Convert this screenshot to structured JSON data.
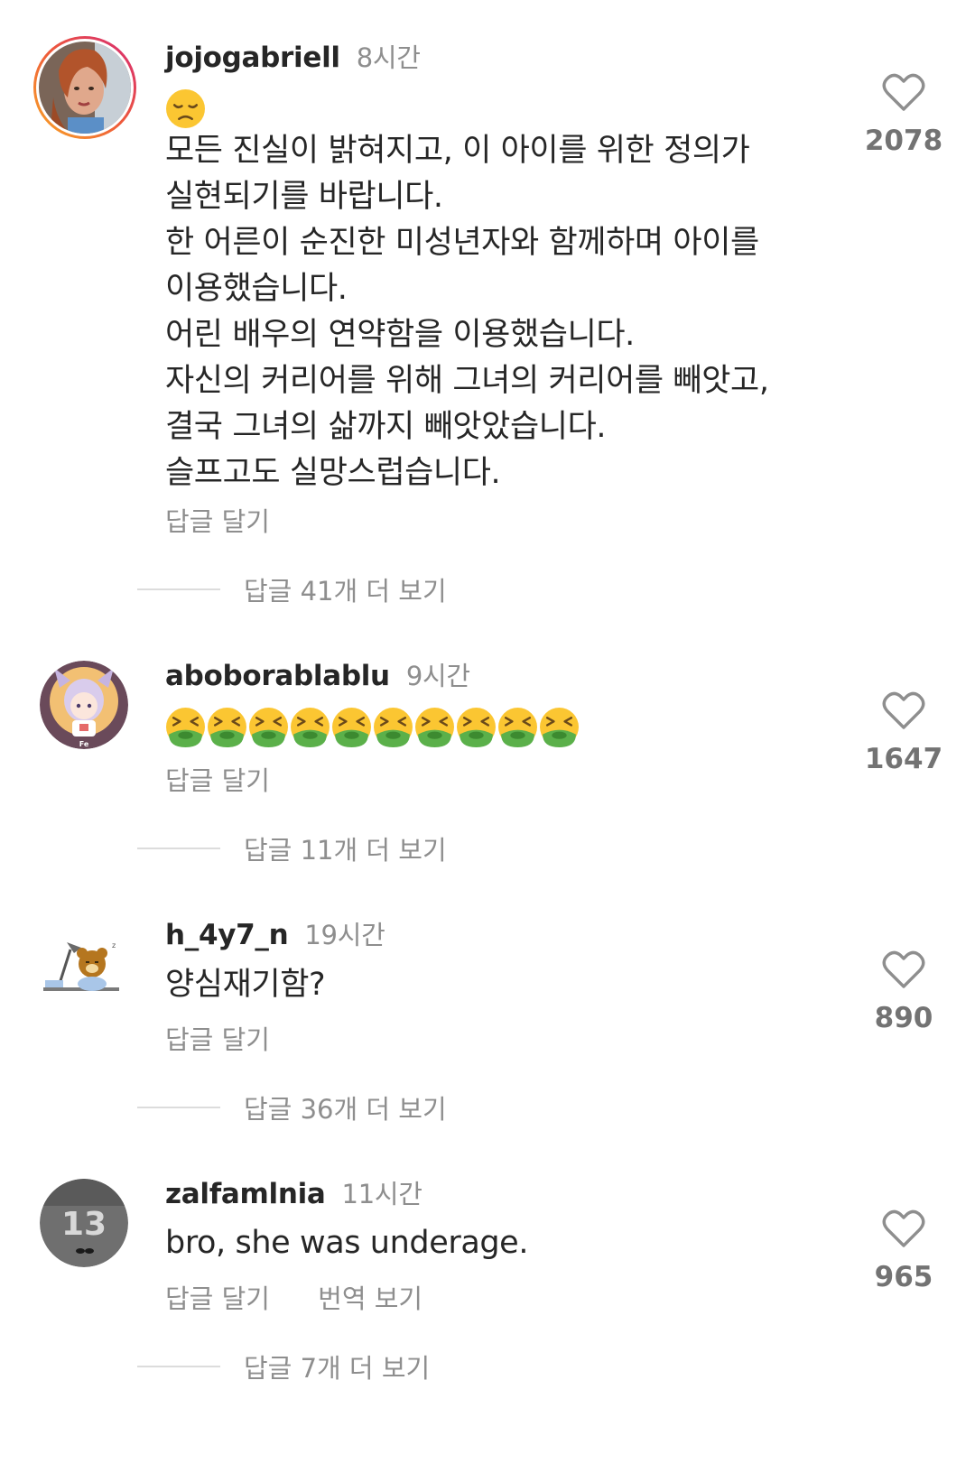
{
  "comments": [
    {
      "username": "jojogabriell",
      "time": "8시간",
      "text_lines": [
        "모든 진실이 밝혀지고, 이 아이를 위한 정의가",
        "실현되기를 바랍니다.",
        "한 어른이 순진한 미성년자와 함께하며 아이를",
        "이용했습니다.",
        "어린 배우의 연약함을 이용했습니다.",
        "자신의 커리어를 위해 그녀의 커리어를 빼앗고,",
        "결국 그녀의 삶까지 빼앗았습니다.",
        "슬프고도 실망스럽습니다."
      ],
      "reply": "답글 달기",
      "more_replies": "답글 41개 더 보기",
      "likes": "2078",
      "emoji": "disappointed-face"
    },
    {
      "username": "aboborablablu",
      "time": "9시간",
      "avatar_badge": "Fe",
      "emoji": "nauseated-face",
      "emoji_count": 10,
      "reply": "답글 달기",
      "more_replies": "답글 11개 더 보기",
      "likes": "1647"
    },
    {
      "username": "h_4y7_n",
      "time": "19시간",
      "text": "양심재기함?",
      "reply": "답글 달기",
      "more_replies": "답글 36개 더 보기",
      "likes": "890"
    },
    {
      "username": "zalfamlnia",
      "time": "11시간",
      "avatar_badge": "13",
      "text": "bro, she was underage.",
      "reply": "답글 달기",
      "translate": "번역 보기",
      "more_replies": "답글 7개 더 보기",
      "likes": "965"
    }
  ],
  "colors": {
    "text": "#262626",
    "muted": "#8e8e8e",
    "story_ring_start": "#f9a826",
    "story_ring_end": "#d62976"
  }
}
